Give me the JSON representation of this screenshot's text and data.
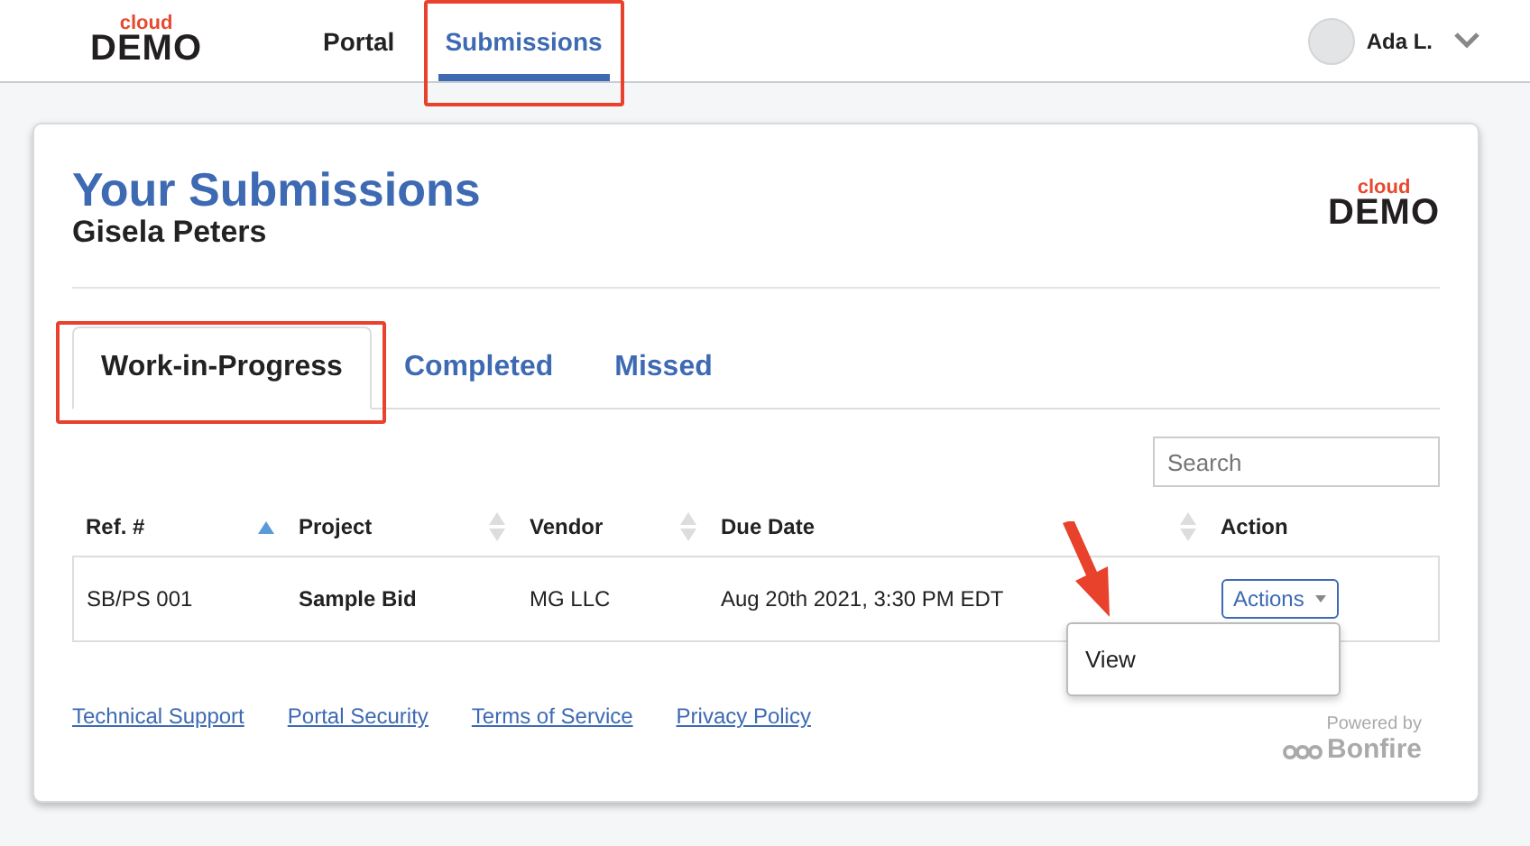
{
  "header": {
    "logo": {
      "top": "cloud",
      "main": "DEMO"
    },
    "nav": [
      {
        "label": "Portal",
        "selected": false,
        "highlighted": false
      },
      {
        "label": "Submissions",
        "selected": true,
        "highlighted": true
      }
    ],
    "user": {
      "name": "Ada L."
    }
  },
  "card": {
    "title": "Your Submissions",
    "subtitle": "Gisela Peters",
    "logo": {
      "top": "cloud",
      "main": "DEMO"
    },
    "tabs": [
      {
        "label": "Work-in-Progress",
        "selected": true,
        "highlighted": true
      },
      {
        "label": "Completed",
        "selected": false,
        "highlighted": false
      },
      {
        "label": "Missed",
        "selected": false,
        "highlighted": false
      }
    ],
    "search": {
      "placeholder": "Search"
    },
    "table": {
      "columns": [
        {
          "label": "Ref. #",
          "sortable": true,
          "sorted": true
        },
        {
          "label": "Project",
          "sortable": true,
          "sorted": false
        },
        {
          "label": "Vendor",
          "sortable": true,
          "sorted": false
        },
        {
          "label": "Due Date",
          "sortable": true,
          "sorted": false
        },
        {
          "label": "Action",
          "sortable": false
        }
      ],
      "rows": [
        {
          "ref": "SB/PS 001",
          "project": "Sample Bid",
          "vendor": "MG LLC",
          "due": "Aug 20th 2021, 3:30 PM EDT",
          "action": "Actions",
          "menu": {
            "open": true,
            "items": [
              "View"
            ]
          }
        }
      ]
    },
    "footer_links": [
      "Technical Support",
      "Portal Security",
      "Terms of Service",
      "Privacy Policy"
    ],
    "powered_by": {
      "label": "Powered by",
      "brand": "Bonfire"
    }
  },
  "annotation_arrow": true
}
